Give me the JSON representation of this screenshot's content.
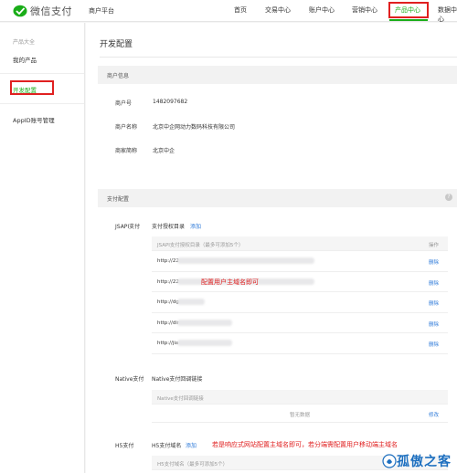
{
  "brand": {
    "logo_text": "微信支付",
    "platform": "商户平台",
    "accent": "#1aad19",
    "annotation_color": "#e02020"
  },
  "nav": {
    "items": [
      {
        "label": "首页",
        "active": false
      },
      {
        "label": "交易中心",
        "active": false
      },
      {
        "label": "账户中心",
        "active": false
      },
      {
        "label": "营销中心",
        "active": false
      },
      {
        "label": "产品中心",
        "active": true
      },
      {
        "label": "数据中心",
        "active": false
      }
    ]
  },
  "sidebar": {
    "category": "产品大全",
    "items": [
      {
        "label": "我的产品"
      },
      {
        "label": "开发配置",
        "active": true
      },
      {
        "label": "AppID账号管理"
      }
    ]
  },
  "page": {
    "title": "开发配置"
  },
  "merchant": {
    "header": "商户信息",
    "rows": [
      {
        "label": "商户号",
        "value": "1482097682"
      },
      {
        "label": "商户名称",
        "value": "北京中企网动力数码科技有限公司"
      },
      {
        "label": "商家简称",
        "value": "北京中企"
      }
    ]
  },
  "payment": {
    "header": "支付配置",
    "help_icon": "question-icon",
    "jsapi": {
      "label": "JSAPI支付",
      "title": "支付授权目录",
      "add": "添加",
      "table_header": "JSAPI支付授权目录（最多可添加5个）",
      "action_header": "操作",
      "rows": [
        {
          "url": "http://22",
          "action": "删除"
        },
        {
          "url": "http://22",
          "action": "删除"
        },
        {
          "url": "http://dg",
          "action": "删除"
        },
        {
          "url": "http://dir",
          "action": "删除"
        },
        {
          "url": "http://jia",
          "action": "删除"
        }
      ]
    },
    "native": {
      "label": "Native支付",
      "title": "Native支付回调链接",
      "table_header": "Native支付回调链接",
      "empty": "暂无数据",
      "action": "修改"
    },
    "h5": {
      "label": "H5支付",
      "title": "H5支付域名",
      "add": "添加",
      "table_header": "H5支付域名（最多可添加5个）"
    }
  },
  "annotations": {
    "jsapi_note": "配置用户主域名即可",
    "h5_note": "若是响应式网站配置主域名即可，若分端需配置用户移动端主域名"
  },
  "watermark": {
    "text": "孤傲之客"
  }
}
